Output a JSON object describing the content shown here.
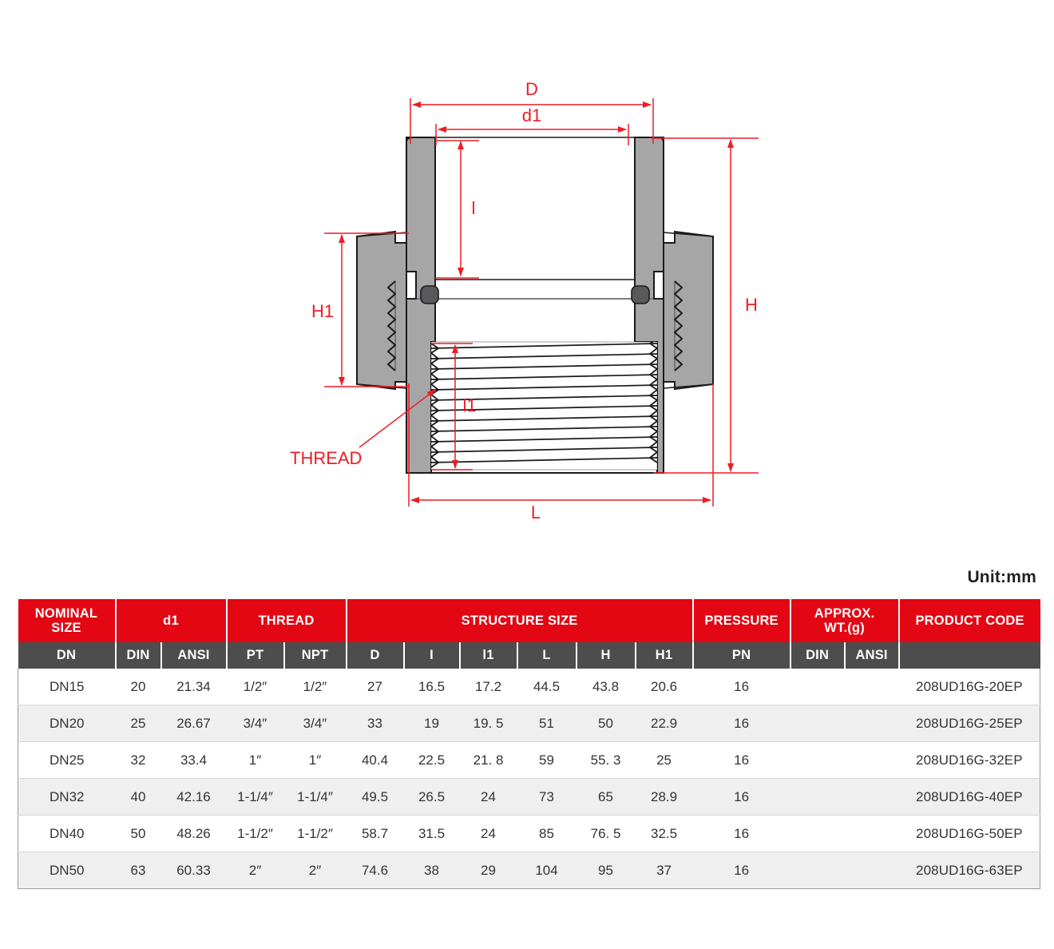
{
  "drawing": {
    "title": "union-pipe-fitting-cross-section",
    "dimension_labels": {
      "outer_diameter": "D",
      "socket_bore": "d1",
      "socket_depth": "l",
      "thread_length": "l1",
      "overall_length": "L",
      "overall_height": "H",
      "nut_height": "H1",
      "thread_callout": "THREAD"
    },
    "colors": {
      "dimension_red": "#ee1c25",
      "body_gray": "#a6a6a6",
      "outline_black": "#1a1a1a",
      "oring_gray": "#59595b"
    }
  },
  "unit_note": "Unit:mm",
  "table": {
    "header_groups": [
      {
        "label": "NOMINAL SIZE",
        "span": 1
      },
      {
        "label": "d1",
        "span": 2
      },
      {
        "label": "THREAD",
        "span": 2
      },
      {
        "label": "STRUCTURE SIZE",
        "span": 6
      },
      {
        "label": "PRESSURE",
        "span": 1
      },
      {
        "label": "APPROX. WT.(g)",
        "span": 2
      },
      {
        "label": "PRODUCT CODE",
        "span": 1
      }
    ],
    "header_group_lines": {
      "nominal_size": [
        "NOMINAL",
        "SIZE"
      ],
      "approx_wt": [
        "APPROX.",
        "WT.(g)"
      ]
    },
    "sub_headers": [
      "DN",
      "DIN",
      "ANSI",
      "PT",
      "NPT",
      "D",
      "I",
      "l1",
      "L",
      "H",
      "H1",
      "PN",
      "DIN",
      "ANSI",
      ""
    ],
    "rows": [
      {
        "dn": "DN15",
        "d1_din": "20",
        "d1_ansi": "21.34",
        "pt": "1/2″",
        "npt": "1/2″",
        "D": "27",
        "I": "16.5",
        "l1": "17.2",
        "L": "44.5",
        "H": "43.8",
        "H1": "20.6",
        "pn": "16",
        "wt_din": "",
        "wt_ansi": "",
        "code": "208UD16G-20EP"
      },
      {
        "dn": "DN20",
        "d1_din": "25",
        "d1_ansi": "26.67",
        "pt": "3/4″",
        "npt": "3/4″",
        "D": "33",
        "I": "19",
        "l1": "19. 5",
        "L": "51",
        "H": "50",
        "H1": "22.9",
        "pn": "16",
        "wt_din": "",
        "wt_ansi": "",
        "code": "208UD16G-25EP"
      },
      {
        "dn": "DN25",
        "d1_din": "32",
        "d1_ansi": "33.4",
        "pt": "1″",
        "npt": "1″",
        "D": "40.4",
        "I": "22.5",
        "l1": "21. 8",
        "L": "59",
        "H": "55. 3",
        "H1": "25",
        "pn": "16",
        "wt_din": "",
        "wt_ansi": "",
        "code": "208UD16G-32EP"
      },
      {
        "dn": "DN32",
        "d1_din": "40",
        "d1_ansi": "42.16",
        "pt": "1-1/4″",
        "npt": "1-1/4″",
        "D": "49.5",
        "I": "26.5",
        "l1": "24",
        "L": "73",
        "H": "65",
        "H1": "28.9",
        "pn": "16",
        "wt_din": "",
        "wt_ansi": "",
        "code": "208UD16G-40EP"
      },
      {
        "dn": "DN40",
        "d1_din": "50",
        "d1_ansi": "48.26",
        "pt": "1-1/2″",
        "npt": "1-1/2″",
        "D": "58.7",
        "I": "31.5",
        "l1": "24",
        "L": "85",
        "H": "76. 5",
        "H1": "32.5",
        "pn": "16",
        "wt_din": "",
        "wt_ansi": "",
        "code": "208UD16G-50EP"
      },
      {
        "dn": "DN50",
        "d1_din": "63",
        "d1_ansi": "60.33",
        "pt": "2″",
        "npt": "2″",
        "D": "74.6",
        "I": "38",
        "l1": "29",
        "L": "104",
        "H": "95",
        "H1": "37",
        "pn": "16",
        "wt_din": "",
        "wt_ansi": "",
        "code": "208UD16G-63EP"
      }
    ],
    "colors": {
      "header_red": "#e30613",
      "header_gray": "#4d4d4d",
      "row_alt": "#efefef",
      "row_base": "#ffffff"
    }
  }
}
